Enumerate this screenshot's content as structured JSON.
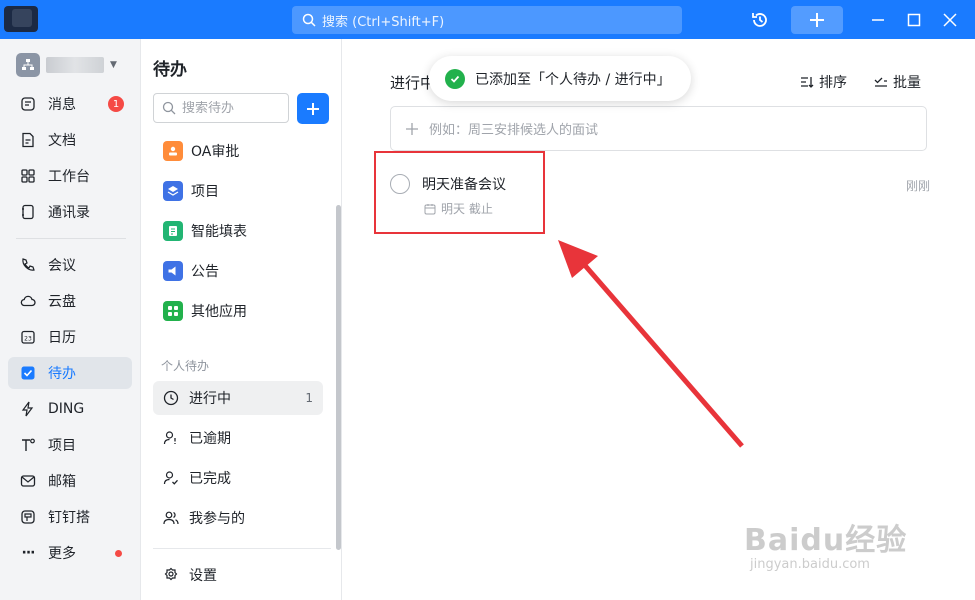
{
  "titlebar": {
    "search_placeholder": "搜索 (Ctrl+Shift+F)",
    "accent": "#1a7bff"
  },
  "leftnav": {
    "items": [
      {
        "label": "消息",
        "icon": "message-icon",
        "badge": "1"
      },
      {
        "label": "文档",
        "icon": "document-icon"
      },
      {
        "label": "工作台",
        "icon": "workbench-icon"
      },
      {
        "label": "通讯录",
        "icon": "contacts-icon"
      },
      {
        "label": "会议",
        "icon": "phone-icon"
      },
      {
        "label": "云盘",
        "icon": "cloud-icon"
      },
      {
        "label": "日历",
        "icon": "calendar-icon",
        "icon_text": "23"
      },
      {
        "label": "待办",
        "icon": "todo-check-icon",
        "active": true
      },
      {
        "label": "DING",
        "icon": "lightning-icon"
      },
      {
        "label": "项目",
        "icon": "project-icon"
      },
      {
        "label": "邮箱",
        "icon": "mail-icon"
      },
      {
        "label": "钉钉搭",
        "icon": "dingda-icon"
      },
      {
        "label": "更多",
        "icon": "more-icon",
        "dot": true
      }
    ]
  },
  "midcol": {
    "title": "待办",
    "search_placeholder": "搜索待办",
    "apps": [
      {
        "label": "OA审批",
        "icon": "oa-approval-icon",
        "color": "#ff8c3a"
      },
      {
        "label": "项目",
        "icon": "project-app-icon",
        "color": "#3f72e5"
      },
      {
        "label": "智能填表",
        "icon": "form-icon",
        "color": "#22b573"
      },
      {
        "label": "公告",
        "icon": "announcement-icon",
        "color": "#3f72e5"
      },
      {
        "label": "其他应用",
        "icon": "other-apps-icon",
        "color": "#22b14c"
      }
    ],
    "section_label": "个人待办",
    "todos": [
      {
        "label": "进行中",
        "icon": "clock-icon",
        "count": "1",
        "active": true
      },
      {
        "label": "已逾期",
        "icon": "person-alert-icon"
      },
      {
        "label": "已完成",
        "icon": "person-check-icon"
      },
      {
        "label": "我参与的",
        "icon": "people-icon"
      }
    ],
    "settings_label": "设置"
  },
  "main": {
    "header": "进行中",
    "sort_label": "排序",
    "batch_label": "批量",
    "toast": "已添加至「个人待办 / 进行中」",
    "add_placeholder": "例如：周三安排候选人的面试",
    "task": {
      "title": "明天准备会议",
      "due": "明天 截止",
      "time": "刚刚"
    }
  },
  "watermark": {
    "main": "Baidu经验",
    "sub": "jingyan.baidu.com"
  }
}
